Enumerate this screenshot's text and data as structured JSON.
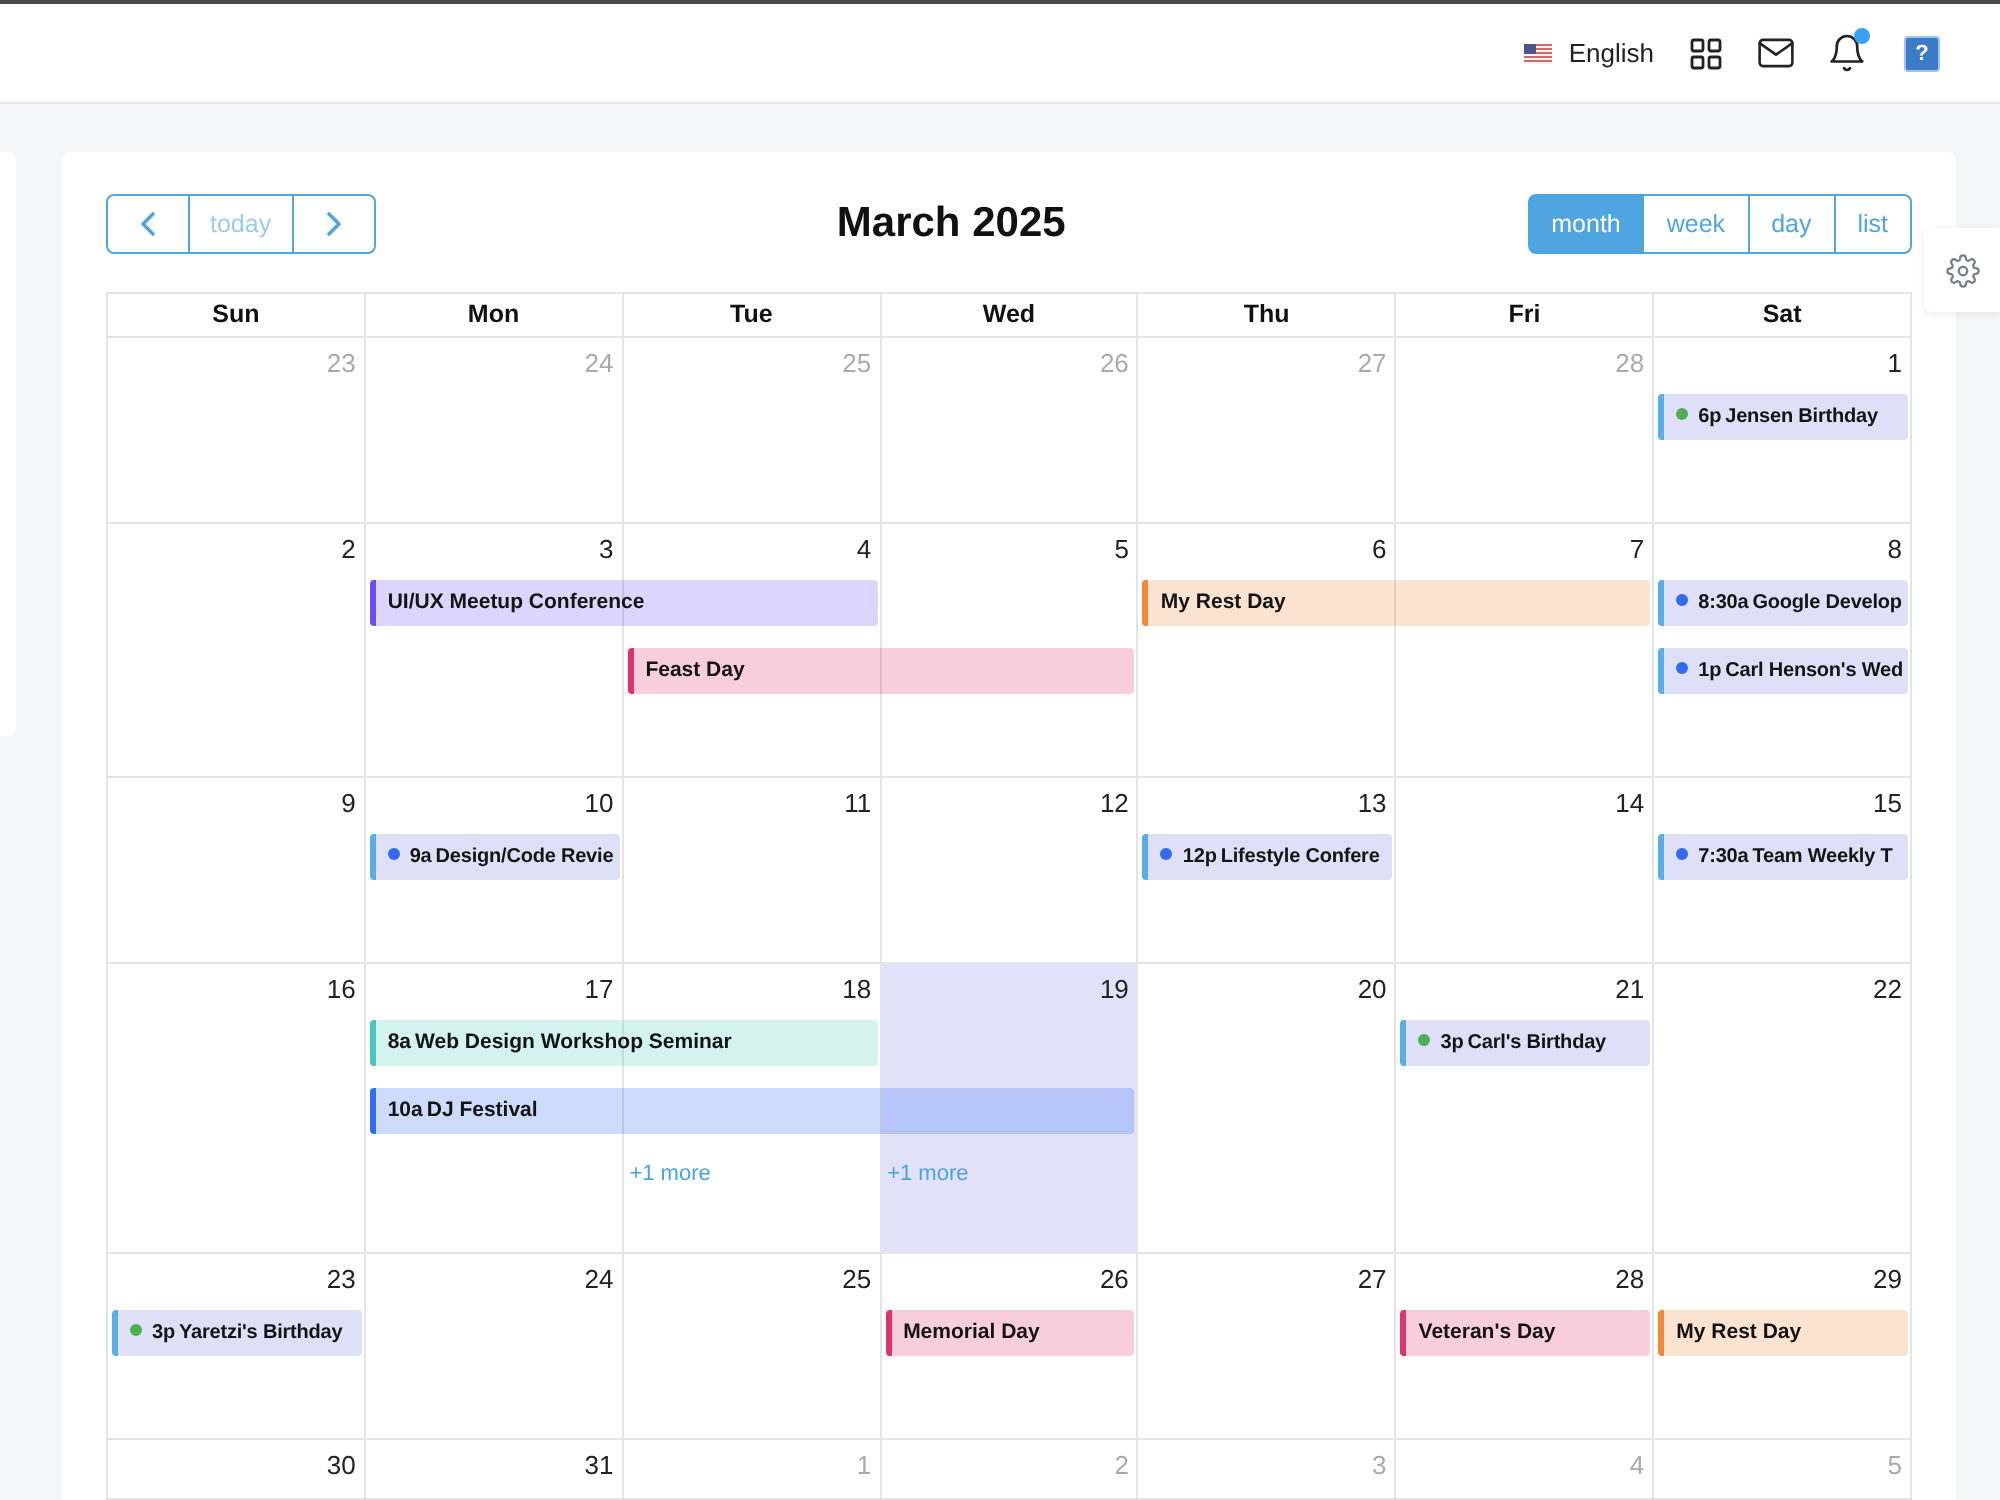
{
  "top_bar": {
    "language": "English",
    "notifications": {
      "unread": true
    },
    "help": "?"
  },
  "calendar": {
    "today_button": {
      "label": "today",
      "disabled": true
    },
    "title": "March 2025",
    "views": [
      {
        "label": "month",
        "selected": true
      },
      {
        "label": "week",
        "selected": false
      },
      {
        "label": "day",
        "selected": false
      },
      {
        "label": "list",
        "selected": false
      }
    ],
    "weekdays": [
      "Sun",
      "Mon",
      "Tue",
      "Wed",
      "Thu",
      "Fri",
      "Sat"
    ],
    "weeks": [
      {
        "days": [
          {
            "date": "23",
            "other_month": true,
            "today": false
          },
          {
            "date": "24",
            "other_month": true,
            "today": false
          },
          {
            "date": "25",
            "other_month": true,
            "today": false
          },
          {
            "date": "26",
            "other_month": true,
            "today": false
          },
          {
            "date": "27",
            "other_month": true,
            "today": false
          },
          {
            "date": "28",
            "other_month": true,
            "today": false
          },
          {
            "date": "1",
            "other_month": false,
            "today": false,
            "events": [
              {
                "kind": "timed",
                "time": "6p",
                "title": "Jensen Birthday",
                "color": "#4caf50"
              }
            ]
          }
        ]
      },
      {
        "days": [
          {
            "date": "2",
            "other_month": false,
            "today": false
          },
          {
            "date": "3",
            "other_month": false,
            "today": false,
            "events": [
              {
                "kind": "twoday",
                "title": "UI/UX Meetup Conference",
                "color": "#6c4ff2"
              }
            ]
          },
          {
            "date": "4",
            "other_month": false,
            "today": false,
            "events": [
              {
                "kind": "twoday",
                "title": "Feast Day",
                "color": "#e0336e"
              }
            ]
          },
          {
            "date": "5",
            "other_month": false,
            "today": false
          },
          {
            "date": "6",
            "other_month": false,
            "today": false,
            "events": [
              {
                "kind": "twoday",
                "title": "My Rest Day",
                "color": "#f0893a"
              }
            ]
          },
          {
            "date": "7",
            "other_month": false,
            "today": false
          },
          {
            "date": "8",
            "other_month": false,
            "today": false,
            "events": [
              {
                "kind": "timed",
                "time": "8:30a",
                "title": "Google Develop",
                "color": "#2f6cf2"
              },
              {
                "kind": "timed",
                "time": "1p",
                "title": "Carl Henson's Wed",
                "color": "#2f6cf2"
              }
            ]
          }
        ]
      },
      {
        "days": [
          {
            "date": "9",
            "other_month": false,
            "today": false
          },
          {
            "date": "10",
            "other_month": false,
            "today": false,
            "events": [
              {
                "kind": "timed",
                "time": "9a",
                "title": "Design/Code Revie",
                "color": "#2f6cf2"
              }
            ]
          },
          {
            "date": "11",
            "other_month": false,
            "today": false
          },
          {
            "date": "12",
            "other_month": false,
            "today": false
          },
          {
            "date": "13",
            "other_month": false,
            "today": false,
            "events": [
              {
                "kind": "timed",
                "time": "12p",
                "title": "Lifestyle Confere",
                "color": "#2f6cf2"
              }
            ]
          },
          {
            "date": "14",
            "other_month": false,
            "today": false
          },
          {
            "date": "15",
            "other_month": false,
            "today": false,
            "events": [
              {
                "kind": "timed",
                "time": "7:30a",
                "title": "Team Weekly T",
                "color": "#2f6cf2"
              }
            ]
          }
        ]
      },
      {
        "days": [
          {
            "date": "16",
            "other_month": false,
            "today": false
          },
          {
            "date": "17",
            "other_month": false,
            "today": false,
            "events": [
              {
                "kind": "twoday",
                "time": "8a",
                "title": "Web Design Workshop Seminar",
                "color": "#4cc7c0"
              },
              {
                "kind": "threeday",
                "time": "10a",
                "title": "DJ Festival",
                "color": "#2f6cf2"
              }
            ]
          },
          {
            "date": "18",
            "other_month": false,
            "today": false,
            "more": "+1 more"
          },
          {
            "date": "19",
            "other_month": false,
            "today": true,
            "more": "+1 more"
          },
          {
            "date": "20",
            "other_month": false,
            "today": false
          },
          {
            "date": "21",
            "other_month": false,
            "today": false,
            "events": [
              {
                "kind": "timed",
                "time": "3p",
                "title": "Carl's Birthday",
                "color": "#4caf50"
              }
            ]
          },
          {
            "date": "22",
            "other_month": false,
            "today": false
          }
        ]
      },
      {
        "days": [
          {
            "date": "23",
            "other_month": false,
            "today": false,
            "events": [
              {
                "kind": "timed",
                "time": "3p",
                "title": "Yaretzi's Birthday",
                "color": "#4caf50"
              }
            ]
          },
          {
            "date": "24",
            "other_month": false,
            "today": false
          },
          {
            "date": "25",
            "other_month": false,
            "today": false
          },
          {
            "date": "26",
            "other_month": false,
            "today": false,
            "events": [
              {
                "kind": "oneday",
                "title": "Memorial Day",
                "color": "#e0336e"
              }
            ]
          },
          {
            "date": "27",
            "other_month": false,
            "today": false
          },
          {
            "date": "28",
            "other_month": false,
            "today": false,
            "events": [
              {
                "kind": "oneday",
                "title": "Veteran's Day",
                "color": "#e0336e"
              }
            ]
          },
          {
            "date": "29",
            "other_month": false,
            "today": false,
            "events": [
              {
                "kind": "oneday",
                "title": "My Rest Day",
                "color": "#f0893a"
              }
            ]
          }
        ]
      },
      {
        "days": [
          {
            "date": "30",
            "other_month": false,
            "today": false
          },
          {
            "date": "31",
            "other_month": false,
            "today": false
          },
          {
            "date": "1",
            "other_month": true,
            "today": false
          },
          {
            "date": "2",
            "other_month": true,
            "today": false
          },
          {
            "date": "3",
            "other_month": true,
            "today": false
          },
          {
            "date": "4",
            "other_month": true,
            "today": false
          },
          {
            "date": "5",
            "other_month": true,
            "today": false
          }
        ]
      }
    ]
  }
}
